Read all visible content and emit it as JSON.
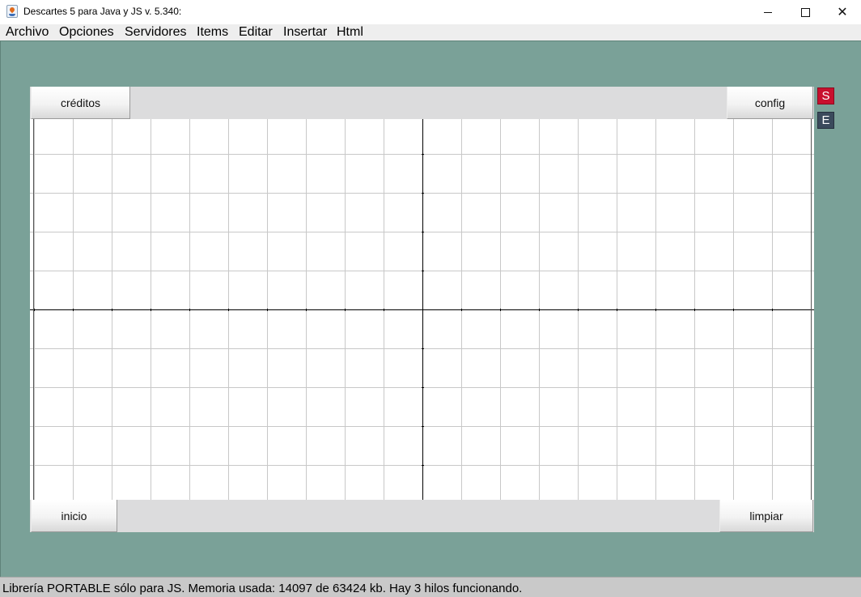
{
  "window": {
    "title": "Descartes 5 para Java y JS v. 5.340:",
    "app_icon": "java-icon",
    "controls": [
      "minimize-icon",
      "maximize-icon",
      "close-icon"
    ]
  },
  "menu": {
    "items": [
      "Archivo",
      "Opciones",
      "Servidores",
      "Items",
      "Editar",
      "Insertar",
      "Html"
    ]
  },
  "scene": {
    "top_bar": {
      "left_button": "créditos",
      "right_button": "config"
    },
    "bottom_bar": {
      "left_button": "inicio",
      "right_button": "limpiar"
    },
    "side_buttons": {
      "s": "S",
      "e": "E"
    },
    "colors": {
      "workspace_bg": "#7aa198",
      "button_bar_bg": "#dcdcdd",
      "grid_line": "#c8c8c8",
      "axis_line": "#000000",
      "side_s_bg": "#c8102e",
      "side_e_bg": "#3b4a5c"
    }
  },
  "status": {
    "text": "Librería PORTABLE sólo para JS. Memoria usada: 14097 de 63424 kb. Hay 3 hilos funcionando."
  }
}
